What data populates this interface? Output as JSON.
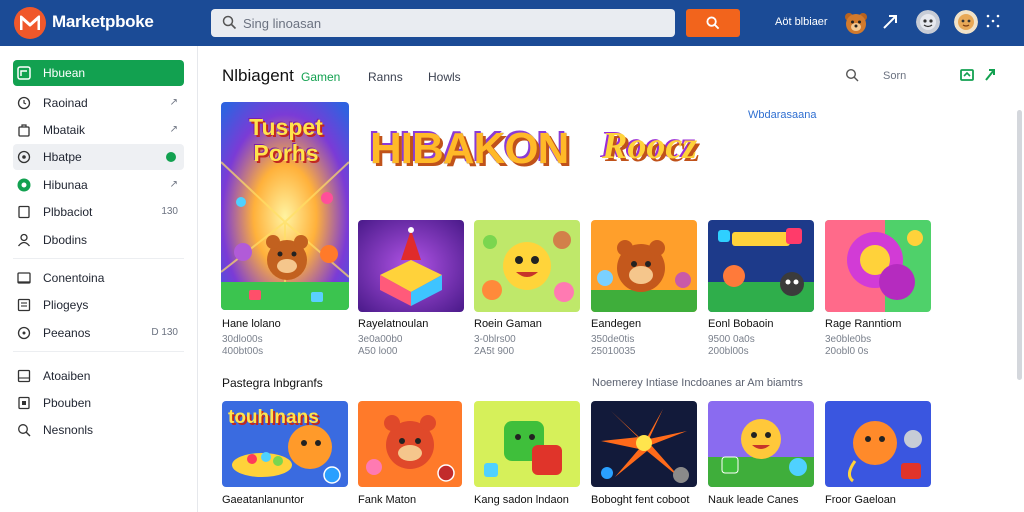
{
  "app": {
    "brand": "Marketpboke",
    "search_placeholder": "Sing linoasan",
    "account_link": "Aöt blbiaer"
  },
  "sidebar": {
    "items": [
      {
        "label": "Hbuean",
        "icon": "home-icon",
        "trail": ""
      },
      {
        "label": "Raoinad",
        "icon": "clock-icon",
        "trail": "↗"
      },
      {
        "label": "Mbataik",
        "icon": "bag-icon",
        "trail": "↗"
      },
      {
        "label": "Hbatpe",
        "icon": "target-icon",
        "trail": ""
      },
      {
        "label": "Hibunaa",
        "icon": "badge-icon",
        "trail": "↗"
      },
      {
        "label": "Plbbaciot",
        "icon": "square-icon",
        "trail": "130"
      },
      {
        "label": "Dbodins",
        "icon": "person-icon",
        "trail": ""
      },
      {
        "label": "Conentoina",
        "icon": "card-icon",
        "trail": ""
      },
      {
        "label": "Pliogeys",
        "icon": "list-icon",
        "trail": ""
      },
      {
        "label": "Peeanos",
        "icon": "circle-icon",
        "trail": "D 130"
      },
      {
        "label": "Atoaiben",
        "icon": "gallery-icon",
        "trail": ""
      },
      {
        "label": "Pbouben",
        "icon": "page-icon",
        "trail": ""
      },
      {
        "label": "Nesnonls",
        "icon": "search-icon",
        "trail": ""
      }
    ]
  },
  "main": {
    "title": "Nlbiagent",
    "tabs": [
      {
        "label": "Gamen"
      },
      {
        "label": "Ranns"
      },
      {
        "label": "Howls"
      }
    ],
    "sort_label": "Sorn",
    "hero_card_text": "Tuspet Porhs",
    "banner_text_left": "HIBAKON",
    "banner_text_right": "Roocz",
    "banner_link": "Wbdarasaana",
    "row1": [
      {
        "title": "Hane lolano",
        "meta1": "30dlo00s",
        "meta2": "400bt00s"
      },
      {
        "title": "Rayelatnoulan",
        "meta1": "3e0a00b0",
        "meta2": "A50 lo00"
      },
      {
        "title": "Roein Gaman",
        "meta1": "3-0blrs00",
        "meta2": "2A5t 900"
      },
      {
        "title": "Eandegen",
        "meta1": "350de0tis",
        "meta2": "25010035"
      },
      {
        "title": "Eonl Bobaoin",
        "meta1": "9500 0a0s",
        "meta2": "200bl00s"
      },
      {
        "title": "Rage Ranntiom",
        "meta1": "3e0ble0bs",
        "meta2": "20obl0 0s"
      }
    ],
    "section2_title": "Pastegra lnbgranfs",
    "section2_link": "Noemerey Intiase Incdoanes ar Am biamtrs",
    "row2": [
      {
        "title": "Gaeatanlanuntor",
        "badge": "touhlnans"
      },
      {
        "title": "Fank Maton"
      },
      {
        "title": "Kang sadon lndaon"
      },
      {
        "title": "Boboght fent coboot"
      },
      {
        "title": "Nauk leade Canes"
      },
      {
        "title": "Froor Gaeloan"
      }
    ]
  },
  "colors": {
    "topbar": "#1b4b96",
    "accent_green": "#12a150",
    "search_button": "#f2641c",
    "logo": "#f0582b"
  }
}
